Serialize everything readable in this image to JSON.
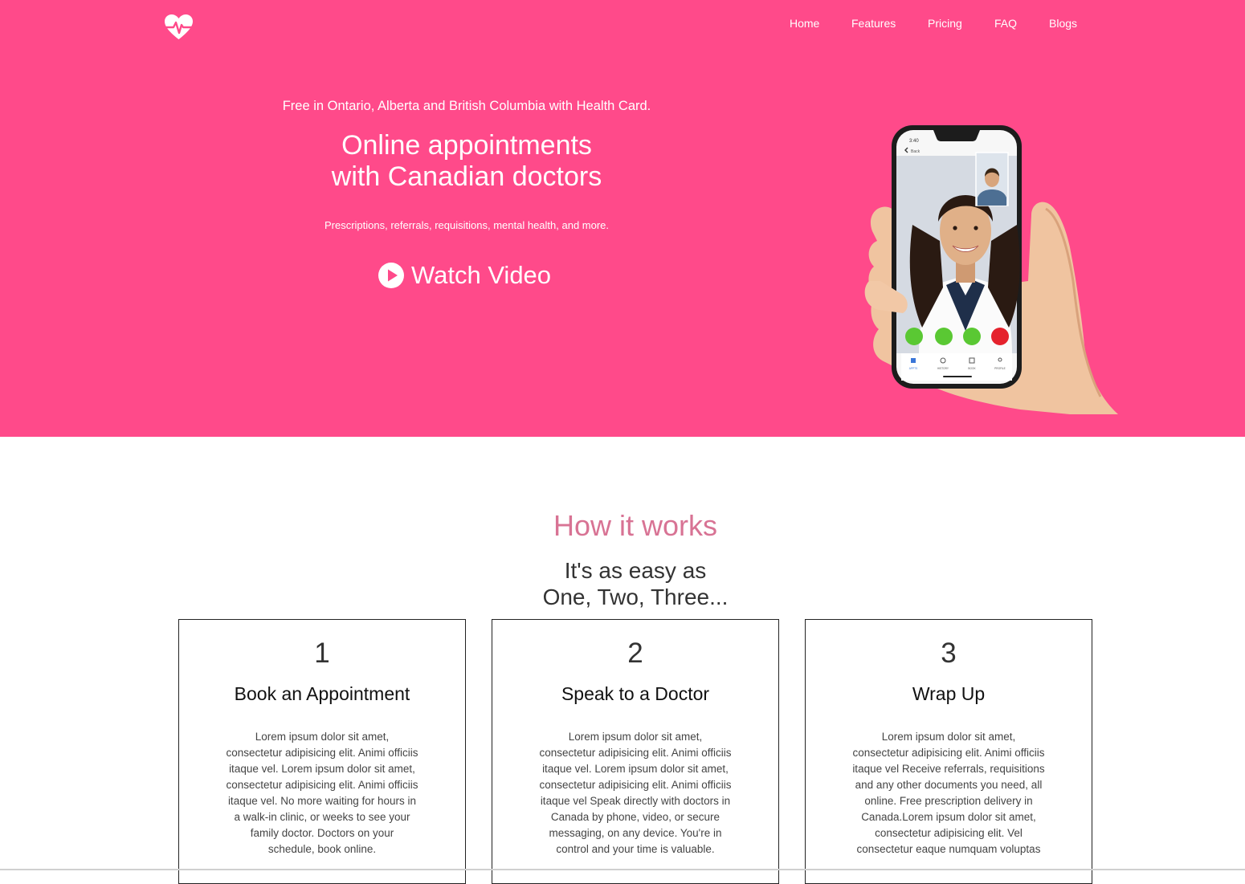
{
  "colors": {
    "hero_bg": "#ff4a8a",
    "accent_title": "#d87394",
    "text_dark": "#333333"
  },
  "header": {
    "logo_icon": "heart-pulse-icon",
    "nav": [
      "Home",
      "Features",
      "Pricing",
      "FAQ",
      "Blogs"
    ]
  },
  "hero": {
    "free_text": "Free in Ontario, Alberta and British Columbia with Health Card.",
    "headline_line1": "Online appointments",
    "headline_line2": "with Canadian doctors",
    "subtitle": "Prescriptions, referrals, requisitions, mental health, and more.",
    "watch_label": "Watch Video",
    "watch_icon": "play-circle-icon",
    "phone_time": "3:40",
    "phone_back": "Back",
    "phone_tabs": [
      "APPTS",
      "HISTORY",
      "BOOK",
      "PROFILE"
    ]
  },
  "how": {
    "title": "How it works",
    "subtitle_line1": "It's as easy as",
    "subtitle_line2": "One, Two, Three...",
    "cards": [
      {
        "number": "1",
        "title": "Book an Appointment",
        "body": "Lorem ipsum dolor sit amet, consectetur adipisicing elit. Animi officiis itaque vel. Lorem ipsum dolor sit amet, consectetur adipisicing elit. Animi officiis itaque vel. No more waiting for hours in a walk-in clinic, or weeks to see your family doctor. Doctors on your schedule, book online."
      },
      {
        "number": "2",
        "title": "Speak to a Doctor",
        "body": "Lorem ipsum dolor sit amet, consectetur adipisicing elit. Animi officiis itaque vel. Lorem ipsum dolor sit amet, consectetur adipisicing elit. Animi officiis itaque vel Speak directly with doctors in Canada by phone, video, or secure messaging, on any device. You're in control and your time is valuable."
      },
      {
        "number": "3",
        "title": "Wrap Up",
        "body": "Lorem ipsum dolor sit amet, consectetur adipisicing elit. Animi officiis itaque vel Receive referrals, requisitions and any other documents you need, all online. Free prescription delivery in Canada.Lorem ipsum dolor sit amet, consectetur adipisicing elit. Vel consectetur eaque numquam voluptas"
      }
    ]
  }
}
